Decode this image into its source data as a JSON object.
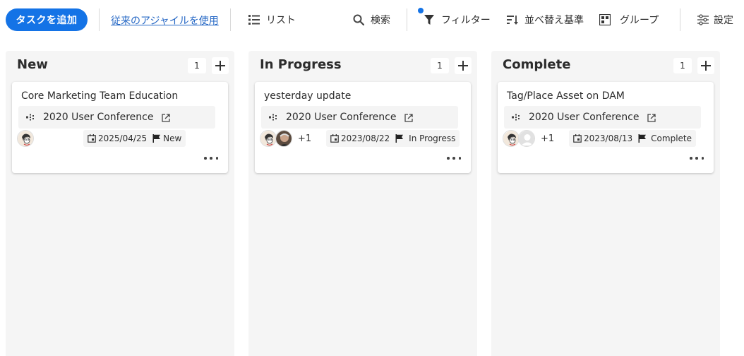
{
  "toolbar": {
    "add_task": "タスクを追加",
    "legacy_agile": "従来のアジャイルを使用",
    "list": "リスト",
    "search": "検索",
    "filter": "フィルター",
    "sort": "並べ替え基準",
    "group": "グループ",
    "settings": "設定",
    "accent_color": "#1473e6"
  },
  "columns": [
    {
      "title": "New",
      "count": "1",
      "card": {
        "title": "Core Marketing Team Education",
        "project": "2020 User Conference",
        "extra_assignees": "",
        "due_date": "2025/04/25",
        "status": "New"
      }
    },
    {
      "title": "In Progress",
      "count": "1",
      "card": {
        "title": "yesterday update",
        "project": "2020 User Conference",
        "extra_assignees": "+1",
        "due_date": "2023/08/22",
        "status": "In Progress"
      }
    },
    {
      "title": "Complete",
      "count": "1",
      "card": {
        "title": "Tag/Place Asset on DAM",
        "project": "2020 User Conference",
        "extra_assignees": "+1",
        "due_date": "2023/08/13",
        "status": "Complete"
      }
    }
  ]
}
